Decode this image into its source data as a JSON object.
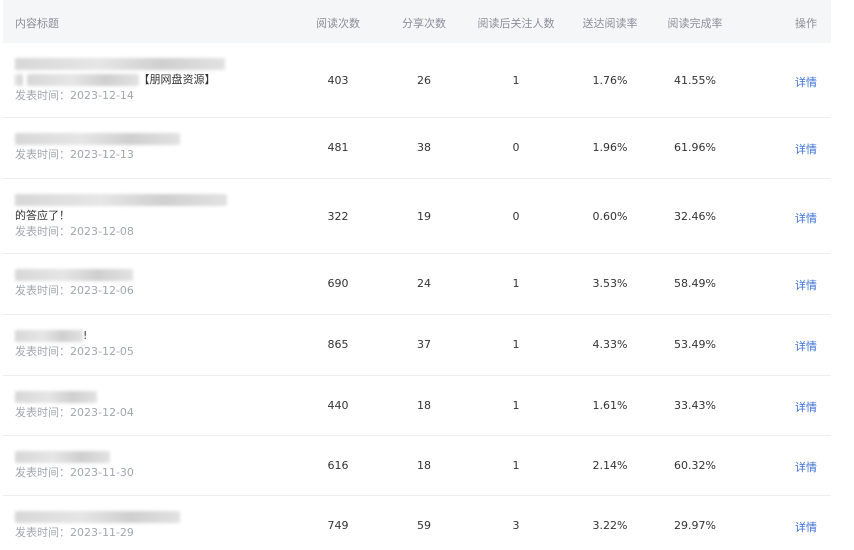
{
  "columns": {
    "title": "内容标题",
    "reads": "阅读次数",
    "shares": "分享次数",
    "follows": "阅读后关注人数",
    "reach_rate": "送达阅读率",
    "complete_rate": "阅读完成率",
    "action": "操作"
  },
  "rows": [
    {
      "title_text": "【朋网盘资源】",
      "date_label": "发表时间：",
      "date": "2023-12-14",
      "reads": "403",
      "shares": "26",
      "follows": "1",
      "reach_rate": "1.76%",
      "complete_rate": "41.55%",
      "action": "详情"
    },
    {
      "title_text": "",
      "date_label": "发表时间：",
      "date": "2023-12-13",
      "reads": "481",
      "shares": "38",
      "follows": "0",
      "reach_rate": "1.96%",
      "complete_rate": "61.96%",
      "action": "详情"
    },
    {
      "title_text": "的答应了！",
      "date_label": "发表时间：",
      "date": "2023-12-08",
      "reads": "322",
      "shares": "19",
      "follows": "0",
      "reach_rate": "0.60%",
      "complete_rate": "32.46%",
      "action": "详情"
    },
    {
      "title_text": "",
      "date_label": "发表时间：",
      "date": "2023-12-06",
      "reads": "690",
      "shares": "24",
      "follows": "1",
      "reach_rate": "3.53%",
      "complete_rate": "58.49%",
      "action": "详情"
    },
    {
      "title_text": "!",
      "date_label": "发表时间：",
      "date": "2023-12-05",
      "reads": "865",
      "shares": "37",
      "follows": "1",
      "reach_rate": "4.33%",
      "complete_rate": "53.49%",
      "action": "详情"
    },
    {
      "title_text": "",
      "date_label": "发表时间：",
      "date": "2023-12-04",
      "reads": "440",
      "shares": "18",
      "follows": "1",
      "reach_rate": "1.61%",
      "complete_rate": "33.43%",
      "action": "详情"
    },
    {
      "title_text": "",
      "date_label": "发表时间：",
      "date": "2023-11-30",
      "reads": "616",
      "shares": "18",
      "follows": "1",
      "reach_rate": "2.14%",
      "complete_rate": "60.32%",
      "action": "详情"
    },
    {
      "title_text": "",
      "date_label": "发表时间：",
      "date": "2023-11-29",
      "reads": "749",
      "shares": "59",
      "follows": "3",
      "reach_rate": "3.22%",
      "complete_rate": "29.97%",
      "action": "详情"
    }
  ]
}
